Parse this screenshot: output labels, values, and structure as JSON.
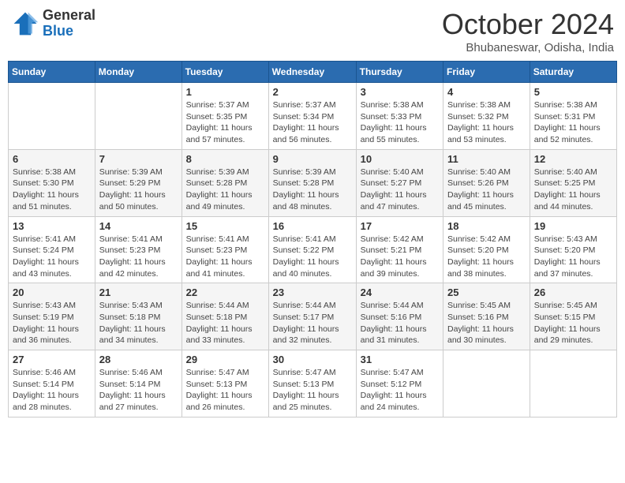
{
  "logo": {
    "general": "General",
    "blue": "Blue"
  },
  "title": "October 2024",
  "location": "Bhubaneswar, Odisha, India",
  "headers": [
    "Sunday",
    "Monday",
    "Tuesday",
    "Wednesday",
    "Thursday",
    "Friday",
    "Saturday"
  ],
  "weeks": [
    [
      {
        "day": "",
        "info": ""
      },
      {
        "day": "",
        "info": ""
      },
      {
        "day": "1",
        "info": "Sunrise: 5:37 AM\nSunset: 5:35 PM\nDaylight: 11 hours and 57 minutes."
      },
      {
        "day": "2",
        "info": "Sunrise: 5:37 AM\nSunset: 5:34 PM\nDaylight: 11 hours and 56 minutes."
      },
      {
        "day": "3",
        "info": "Sunrise: 5:38 AM\nSunset: 5:33 PM\nDaylight: 11 hours and 55 minutes."
      },
      {
        "day": "4",
        "info": "Sunrise: 5:38 AM\nSunset: 5:32 PM\nDaylight: 11 hours and 53 minutes."
      },
      {
        "day": "5",
        "info": "Sunrise: 5:38 AM\nSunset: 5:31 PM\nDaylight: 11 hours and 52 minutes."
      }
    ],
    [
      {
        "day": "6",
        "info": "Sunrise: 5:38 AM\nSunset: 5:30 PM\nDaylight: 11 hours and 51 minutes."
      },
      {
        "day": "7",
        "info": "Sunrise: 5:39 AM\nSunset: 5:29 PM\nDaylight: 11 hours and 50 minutes."
      },
      {
        "day": "8",
        "info": "Sunrise: 5:39 AM\nSunset: 5:28 PM\nDaylight: 11 hours and 49 minutes."
      },
      {
        "day": "9",
        "info": "Sunrise: 5:39 AM\nSunset: 5:28 PM\nDaylight: 11 hours and 48 minutes."
      },
      {
        "day": "10",
        "info": "Sunrise: 5:40 AM\nSunset: 5:27 PM\nDaylight: 11 hours and 47 minutes."
      },
      {
        "day": "11",
        "info": "Sunrise: 5:40 AM\nSunset: 5:26 PM\nDaylight: 11 hours and 45 minutes."
      },
      {
        "day": "12",
        "info": "Sunrise: 5:40 AM\nSunset: 5:25 PM\nDaylight: 11 hours and 44 minutes."
      }
    ],
    [
      {
        "day": "13",
        "info": "Sunrise: 5:41 AM\nSunset: 5:24 PM\nDaylight: 11 hours and 43 minutes."
      },
      {
        "day": "14",
        "info": "Sunrise: 5:41 AM\nSunset: 5:23 PM\nDaylight: 11 hours and 42 minutes."
      },
      {
        "day": "15",
        "info": "Sunrise: 5:41 AM\nSunset: 5:23 PM\nDaylight: 11 hours and 41 minutes."
      },
      {
        "day": "16",
        "info": "Sunrise: 5:41 AM\nSunset: 5:22 PM\nDaylight: 11 hours and 40 minutes."
      },
      {
        "day": "17",
        "info": "Sunrise: 5:42 AM\nSunset: 5:21 PM\nDaylight: 11 hours and 39 minutes."
      },
      {
        "day": "18",
        "info": "Sunrise: 5:42 AM\nSunset: 5:20 PM\nDaylight: 11 hours and 38 minutes."
      },
      {
        "day": "19",
        "info": "Sunrise: 5:43 AM\nSunset: 5:20 PM\nDaylight: 11 hours and 37 minutes."
      }
    ],
    [
      {
        "day": "20",
        "info": "Sunrise: 5:43 AM\nSunset: 5:19 PM\nDaylight: 11 hours and 36 minutes."
      },
      {
        "day": "21",
        "info": "Sunrise: 5:43 AM\nSunset: 5:18 PM\nDaylight: 11 hours and 34 minutes."
      },
      {
        "day": "22",
        "info": "Sunrise: 5:44 AM\nSunset: 5:18 PM\nDaylight: 11 hours and 33 minutes."
      },
      {
        "day": "23",
        "info": "Sunrise: 5:44 AM\nSunset: 5:17 PM\nDaylight: 11 hours and 32 minutes."
      },
      {
        "day": "24",
        "info": "Sunrise: 5:44 AM\nSunset: 5:16 PM\nDaylight: 11 hours and 31 minutes."
      },
      {
        "day": "25",
        "info": "Sunrise: 5:45 AM\nSunset: 5:16 PM\nDaylight: 11 hours and 30 minutes."
      },
      {
        "day": "26",
        "info": "Sunrise: 5:45 AM\nSunset: 5:15 PM\nDaylight: 11 hours and 29 minutes."
      }
    ],
    [
      {
        "day": "27",
        "info": "Sunrise: 5:46 AM\nSunset: 5:14 PM\nDaylight: 11 hours and 28 minutes."
      },
      {
        "day": "28",
        "info": "Sunrise: 5:46 AM\nSunset: 5:14 PM\nDaylight: 11 hours and 27 minutes."
      },
      {
        "day": "29",
        "info": "Sunrise: 5:47 AM\nSunset: 5:13 PM\nDaylight: 11 hours and 26 minutes."
      },
      {
        "day": "30",
        "info": "Sunrise: 5:47 AM\nSunset: 5:13 PM\nDaylight: 11 hours and 25 minutes."
      },
      {
        "day": "31",
        "info": "Sunrise: 5:47 AM\nSunset: 5:12 PM\nDaylight: 11 hours and 24 minutes."
      },
      {
        "day": "",
        "info": ""
      },
      {
        "day": "",
        "info": ""
      }
    ]
  ]
}
